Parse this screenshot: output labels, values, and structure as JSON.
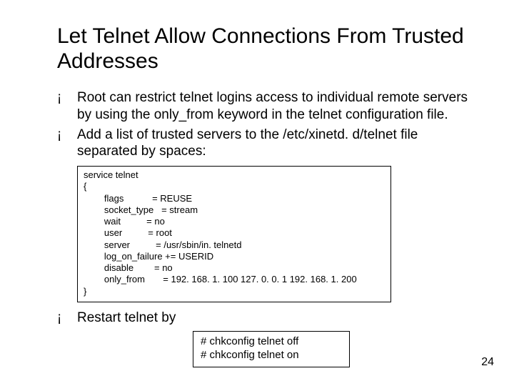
{
  "title": "Let Telnet Allow Connections From Trusted Addresses",
  "bullets": {
    "b1": "Root can restrict telnet logins access to individual remote servers by using the only_from keyword in the telnet configuration file.",
    "b2": "Add a list of trusted servers to the /etc/xinetd. d/telnet file separated by spaces:",
    "b3": "Restart telnet by"
  },
  "code1": "service telnet\n{\n        flags           = REUSE\n        socket_type   = stream\n        wait          = no\n        user          = root\n        server          = /usr/sbin/in. telnetd\n        log_on_failure += USERID\n        disable        = no\n        only_from       = 192. 168. 1. 100 127. 0. 0. 1 192. 168. 1. 200\n}",
  "code2": "# chkconfig telnet off\n# chkconfig telnet on",
  "page": "24"
}
